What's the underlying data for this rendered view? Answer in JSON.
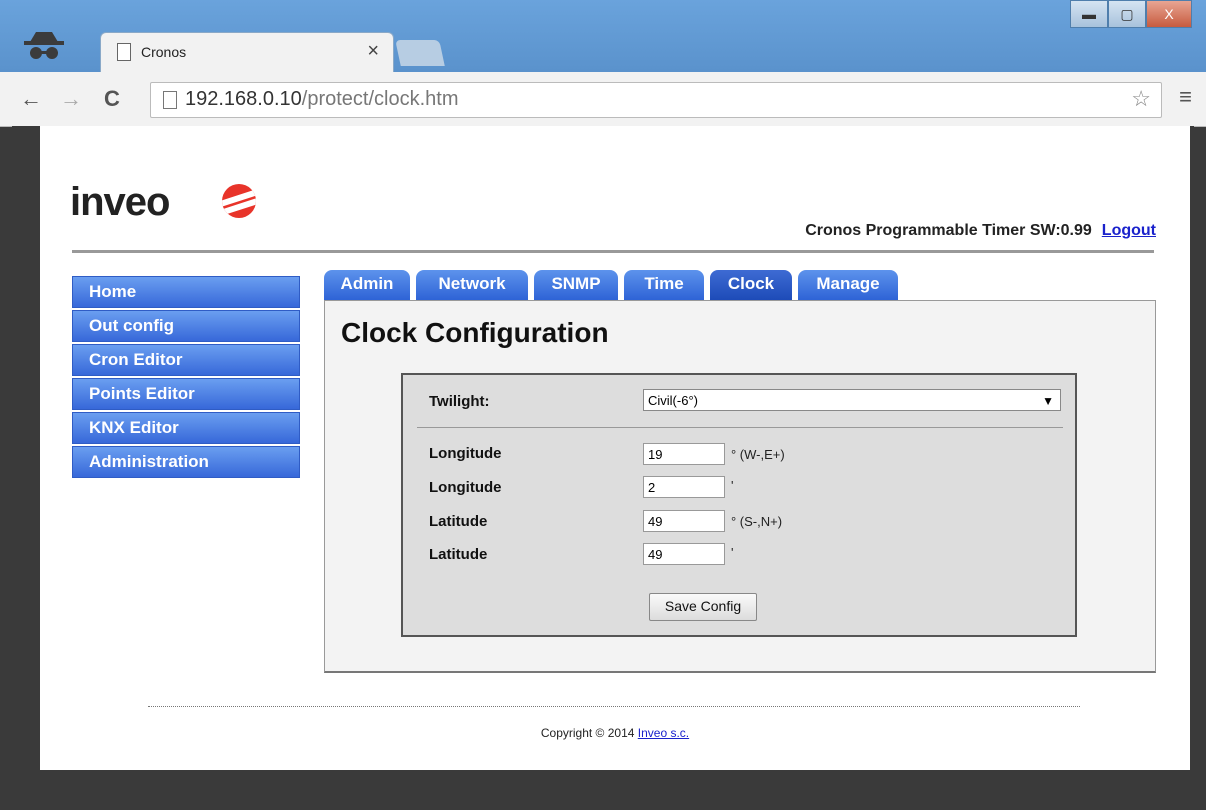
{
  "browser": {
    "tab_title": "Cronos",
    "tab_close": "×",
    "url_host": "192.168.0.10",
    "url_path": "/protect/clock.htm",
    "back": "←",
    "forward": "→",
    "reload": "C",
    "star": "☆",
    "menu": "≡",
    "win_min": "▬",
    "win_max": "▢",
    "win_close": "X"
  },
  "header": {
    "logo_text": "inveo",
    "product": "Cronos Programmable Timer SW:0.99",
    "logout": "Logout"
  },
  "sidebar": {
    "items": [
      {
        "label": "Home"
      },
      {
        "label": "Out config"
      },
      {
        "label": "Cron Editor"
      },
      {
        "label": "Points Editor"
      },
      {
        "label": "KNX Editor"
      },
      {
        "label": "Administration"
      }
    ]
  },
  "tabs": [
    {
      "label": "Admin"
    },
    {
      "label": "Network"
    },
    {
      "label": "SNMP"
    },
    {
      "label": "Time"
    },
    {
      "label": "Clock",
      "active": true
    },
    {
      "label": "Manage"
    }
  ],
  "content": {
    "title": "Clock Configuration",
    "twilight_label": "Twilight:",
    "twilight_value": "Civil(-6°)",
    "rows": [
      {
        "label": "Longitude",
        "value": "19",
        "unit": "° (W-,E+)"
      },
      {
        "label": "Longitude",
        "value": "2",
        "unit": "'"
      },
      {
        "label": "Latitude",
        "value": "49",
        "unit": "° (S-,N+)"
      },
      {
        "label": "Latitude",
        "value": "49",
        "unit": "'"
      }
    ],
    "save_button": "Save Config"
  },
  "footer": {
    "copyright": "Copyright © 2014",
    "company_link": "Inveo s.c."
  }
}
